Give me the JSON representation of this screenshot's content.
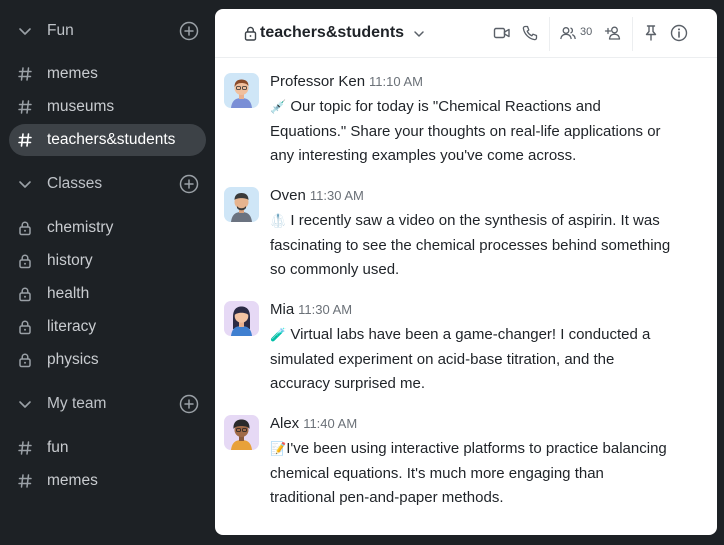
{
  "sidebar": {
    "sections": [
      {
        "label": "Fun",
        "items": [
          {
            "label": "memes",
            "type": "hash",
            "active": false
          },
          {
            "label": "museums",
            "type": "hash",
            "active": false
          },
          {
            "label": "teachers&students",
            "type": "hash",
            "active": true
          }
        ]
      },
      {
        "label": "Classes",
        "items": [
          {
            "label": "chemistry",
            "type": "lock",
            "active": false
          },
          {
            "label": "history",
            "type": "lock",
            "active": false
          },
          {
            "label": "health",
            "type": "lock",
            "active": false
          },
          {
            "label": "literacy",
            "type": "lock",
            "active": false
          },
          {
            "label": "physics",
            "type": "lock",
            "active": false
          }
        ]
      },
      {
        "label": "My team",
        "items": [
          {
            "label": "fun",
            "type": "hash",
            "active": false
          },
          {
            "label": "memes",
            "type": "hash",
            "active": false
          }
        ]
      }
    ]
  },
  "header": {
    "channel": "teachers&students",
    "member_count": "30",
    "icons": [
      "lock-icon",
      "chevron-down-icon",
      "video-call-icon",
      "phone-icon",
      "members-icon",
      "add-member-icon",
      "pin-icon",
      "info-icon"
    ]
  },
  "messages": [
    {
      "author": "Professor Ken",
      "time": "11:10 AM",
      "emoji": "💉",
      "text": "Our topic for today is \"Chemical Reactions and",
      "line2": "Equations.\" Share your thoughts on real-life applications or",
      "line3": "any interesting examples you've come across.",
      "avatar_color": "#cfe6f7"
    },
    {
      "author": "Oven",
      "time": "11:30 AM",
      "emoji": "🥼",
      "text": "I recently saw a video on the synthesis of aspirin. It was",
      "line2": "fascinating to see the chemical processes behind something",
      "line3": "so commonly used.",
      "avatar_color": "#cfe6f7"
    },
    {
      "author": "Mia",
      "time": "11:30 AM",
      "emoji": "🧪",
      "text": "Virtual labs have been a game-changer! I conducted a",
      "line2": "simulated experiment on acid-base titration, and the",
      "line3": "accuracy surprised me.",
      "avatar_color": "#e6d9f5"
    },
    {
      "author": "Alex",
      "time": "11:40 AM",
      "emoji": "📝",
      "text": "I've been using interactive platforms to practice balancing",
      "line2": "chemical equations. It's much more engaging than",
      "line3": "traditional pen-and-paper methods.",
      "avatar_color": "#e6d9f5"
    }
  ],
  "colors": {
    "sidebar_bg": "#1d2125",
    "active_item_bg": "#3d4247",
    "main_bg": "#ffffff"
  }
}
